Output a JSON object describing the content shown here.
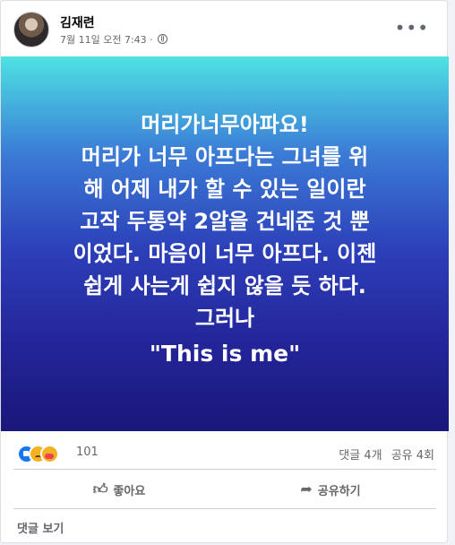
{
  "post": {
    "author": "김재련",
    "timestamp": "7월 11일 오전 7:43",
    "more_icon": "more-horizontal-icon",
    "privacy_icon": "globe-icon"
  },
  "image": {
    "lines": [
      "머리가너무아파요!",
      "머리가 너무 아프다는 그녀를 위",
      "해 어제 내가 할 수 있는 일이란",
      "고작 두통약 2알을 건네준 것 뿐",
      "이었다. 마음이 너무 아프다. 이젠",
      "쉽게 사는게 쉽지 않을 듯 하다.",
      "그러나"
    ],
    "highlight": "\"This is me\"",
    "colors": {
      "gradient_top": "#4ee2e3",
      "gradient_bottom": "#19177a",
      "text": "#ffffff"
    }
  },
  "engagement": {
    "reaction_count": "101",
    "comments": "댓글 4개",
    "shares": "공유 4회",
    "reaction_icons": [
      "like-reaction-icon",
      "sad-reaction-icon",
      "care-reaction-icon"
    ]
  },
  "actions": {
    "like_label": "좋아요",
    "share_label": "공유하기"
  },
  "footer": {
    "view_comments": "댓글 보기"
  }
}
